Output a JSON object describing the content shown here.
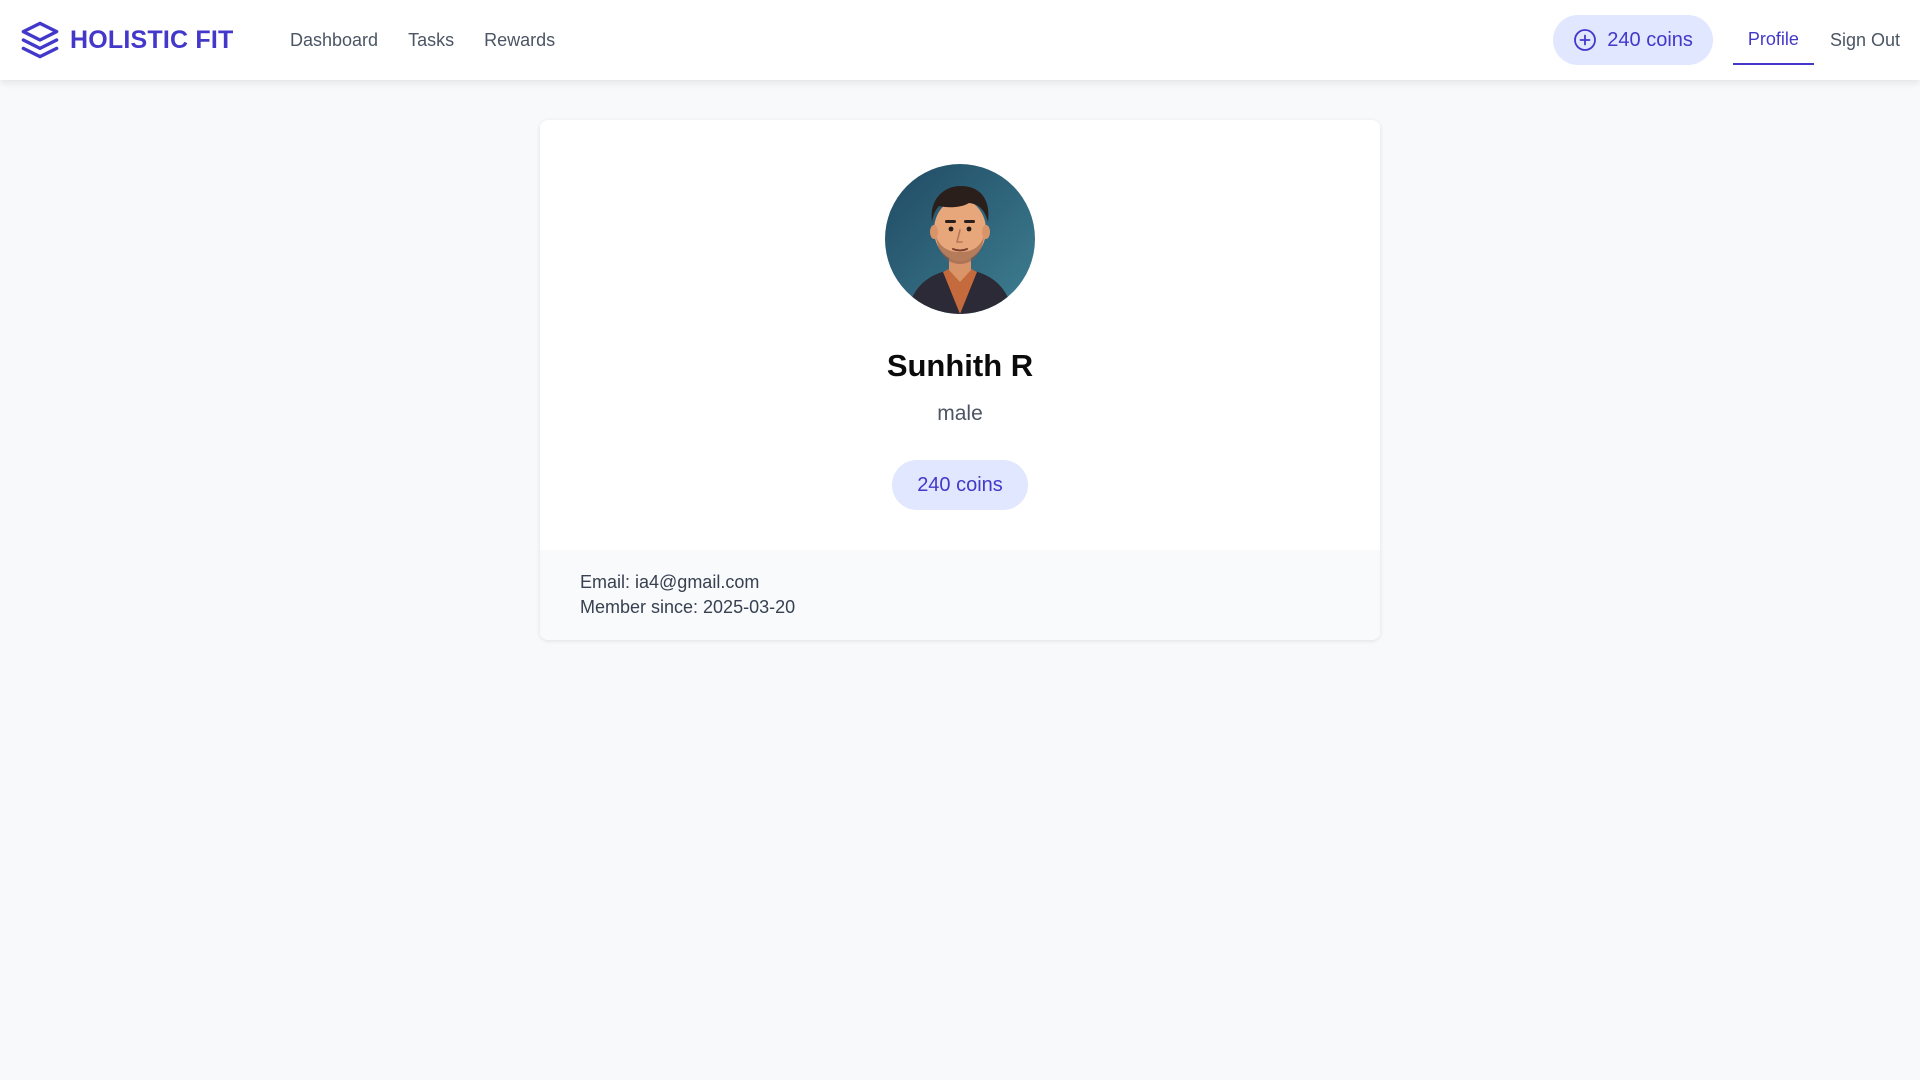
{
  "brand": {
    "name": "HOLISTIC FIT",
    "icon": "layers-icon",
    "color": "#4338ca"
  },
  "nav": {
    "links": [
      {
        "label": "Dashboard"
      },
      {
        "label": "Tasks"
      },
      {
        "label": "Rewards"
      }
    ],
    "coins_label": "240 coins",
    "profile_label": "Profile",
    "signout_label": "Sign Out"
  },
  "profile": {
    "name": "Sunhith R",
    "gender": "male",
    "coins_label": "240 coins",
    "email_line": "Email: ia4@gmail.com",
    "member_since_line": "Member since: 2025-03-20"
  },
  "colors": {
    "accent": "#4338ca",
    "pill_bg": "#e0e7ff",
    "page_bg": "#f8f9fb"
  }
}
